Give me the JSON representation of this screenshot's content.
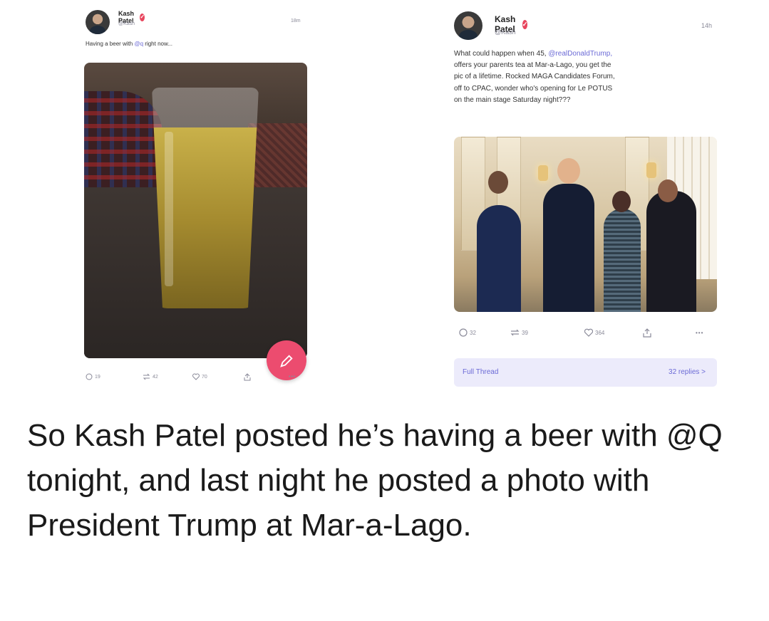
{
  "left_post": {
    "author": "Kash Patel",
    "handle": "@Kash",
    "time": "18m",
    "text_before": "Having a beer with ",
    "mention": "@q",
    "text_after": " right now...",
    "actions": {
      "replies": "19",
      "reposts": "42",
      "likes": "70"
    },
    "photo": "beer-glass"
  },
  "right_post": {
    "author": "Kash Patel",
    "handle": "@Kash",
    "time": "14h",
    "text_line1_before": "What could happen when 45, ",
    "mention": "@realDonaldTrump,",
    "text_line2": "offers your parents tea at Mar-a-Lago, you get the",
    "text_line3": "pic of a lifetime. Rocked MAGA Candidates Forum,",
    "text_line4": "off to CPAC, wonder who's opening for Le POTUS",
    "text_line5": "on the main stage Saturday night???",
    "actions": {
      "replies": "32",
      "reposts": "39",
      "likes": "364"
    },
    "full_thread": "Full Thread",
    "replies_link": "32 replies >",
    "photo": "group-photo-mar-a-lago"
  },
  "caption": "So Kash Patel posted he’s having a beer with @Q tonight, and last night he posted a photo with President Trump at Mar-a-Lago.",
  "colors": {
    "accent": "#ec4c6f",
    "link": "#6b6ad6",
    "thread_bg": "#ecebfb"
  },
  "icons": {
    "verified": "check",
    "compose": "pencil",
    "reply": "speech-bubble",
    "repost": "arrows",
    "like": "heart",
    "share": "upload",
    "more": "ellipsis"
  }
}
